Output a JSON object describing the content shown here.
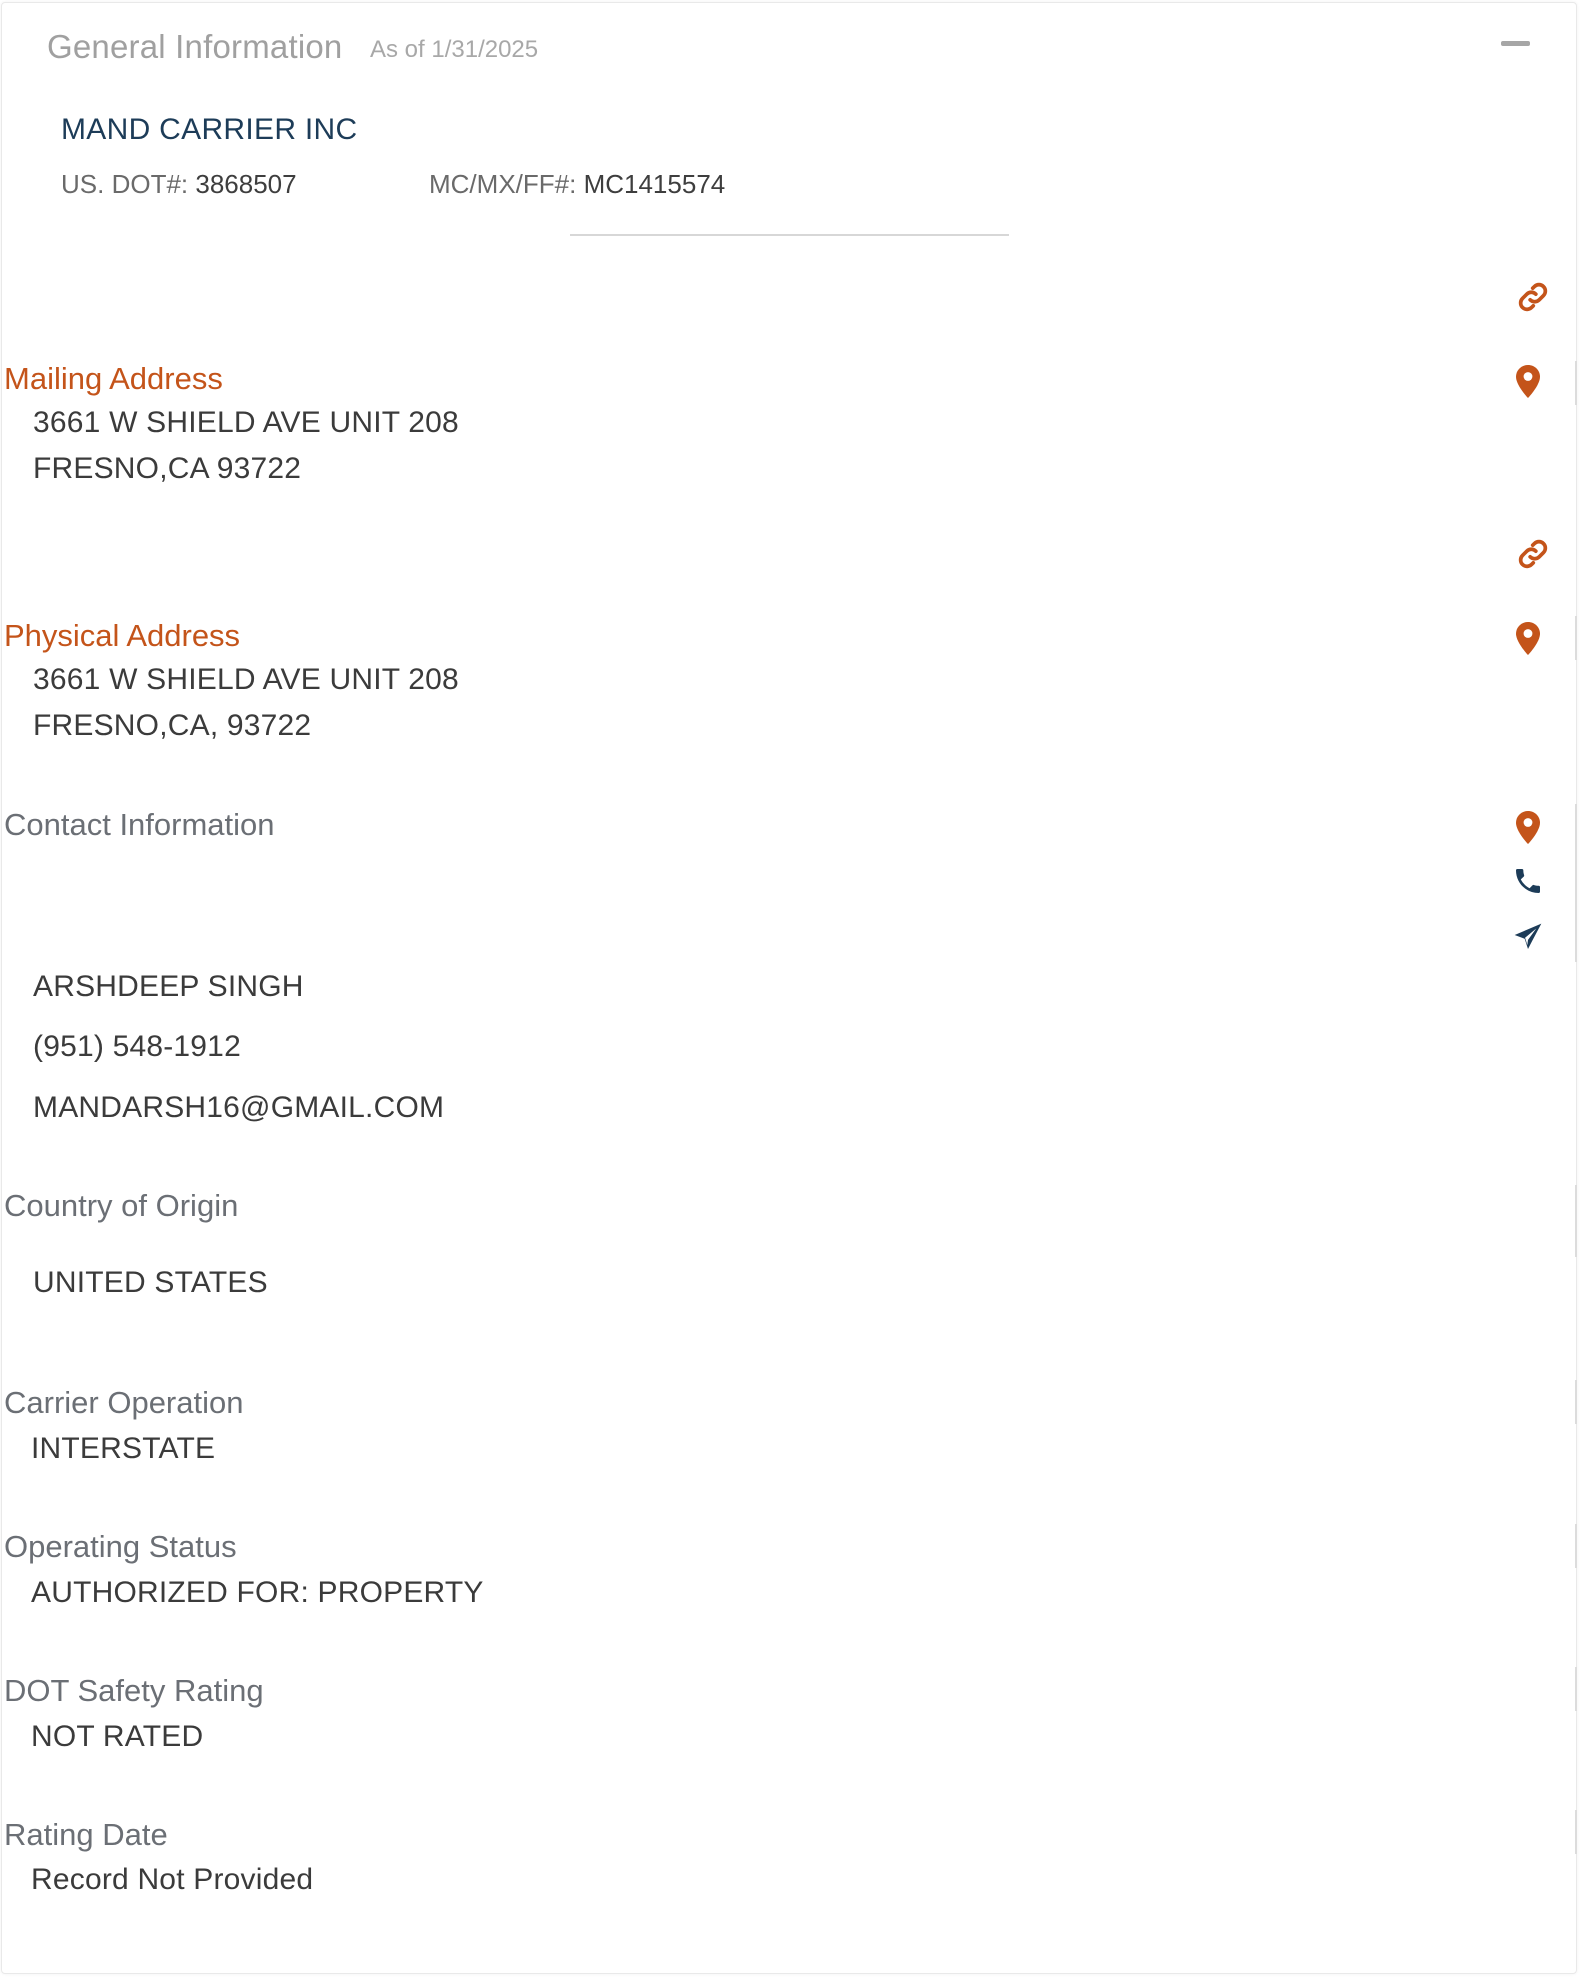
{
  "header": {
    "title": "General Information",
    "as_of": "As of 1/31/2025"
  },
  "company": {
    "name": "MAND CARRIER INC",
    "dot_label": "US. DOT#:",
    "dot_value": "3868507",
    "mc_label": "MC/MX/FF#:",
    "mc_value": "MC1415574"
  },
  "mailing": {
    "heading": "Mailing Address",
    "line1": "3661 W SHIELD AVE UNIT 208",
    "line2": "FRESNO,CA 93722"
  },
  "physical": {
    "heading": "Physical Address",
    "line1": "3661 W SHIELD AVE UNIT 208",
    "line2": "FRESNO,CA, 93722"
  },
  "contact": {
    "heading": "Contact Information",
    "name": "ARSHDEEP SINGH",
    "phone": "(951) 548-1912",
    "email": "MANDARSH16@GMAIL.COM"
  },
  "country": {
    "heading": "Country of Origin",
    "value": "UNITED STATES"
  },
  "operation": {
    "heading": "Carrier Operation",
    "value": "INTERSTATE"
  },
  "status": {
    "heading": "Operating Status",
    "value": "AUTHORIZED FOR: PROPERTY"
  },
  "safety": {
    "heading": "DOT Safety Rating",
    "value": "NOT RATED"
  },
  "rating_date": {
    "heading": "Rating Date",
    "value": "Record Not Provided"
  },
  "icons": {
    "link": "link-icon",
    "map_pin": "map-pin-icon",
    "phone": "phone-icon",
    "send": "paper-plane-icon",
    "collapse": "minus-icon"
  },
  "colors": {
    "accent_orange": "#c4541a",
    "navy": "#1d3c58",
    "heading_gray": "#6b6f75"
  }
}
